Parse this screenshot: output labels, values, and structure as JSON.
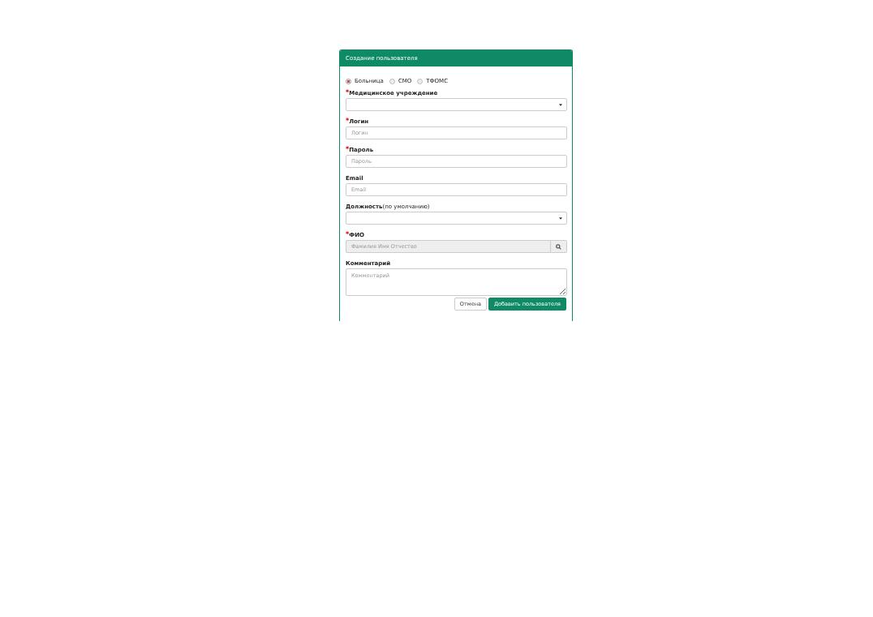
{
  "dialog": {
    "title": "Создание пользователя",
    "org_types": [
      {
        "label": "Больница",
        "selected": true
      },
      {
        "label": "СМО",
        "selected": false
      },
      {
        "label": "ТФОМС",
        "selected": false
      }
    ],
    "fields": [
      {
        "kind": "select",
        "label": "Медицинское учреждение",
        "required_mark": "*"
      },
      {
        "kind": "input",
        "label": "Логин",
        "required_mark": "*",
        "placeholder": "Логин"
      },
      {
        "kind": "input",
        "label": "Пароль",
        "required_mark": "*",
        "placeholder": "Пароль"
      },
      {
        "kind": "input",
        "label": "Email",
        "placeholder": "Email"
      },
      {
        "kind": "select",
        "label": "Должность",
        "hint": "(по умолчанию)"
      },
      {
        "kind": "search",
        "label": "ФИО",
        "required_mark": "*",
        "placeholder": "Фамилия Имя Отчество",
        "disabled": true
      },
      {
        "kind": "textarea",
        "label": "Комментарий",
        "placeholder": "Комментарий"
      }
    ],
    "buttons": [
      {
        "label": "Отмена",
        "kind": "default"
      },
      {
        "label": "Добавить пользователя",
        "kind": "primary"
      }
    ]
  }
}
